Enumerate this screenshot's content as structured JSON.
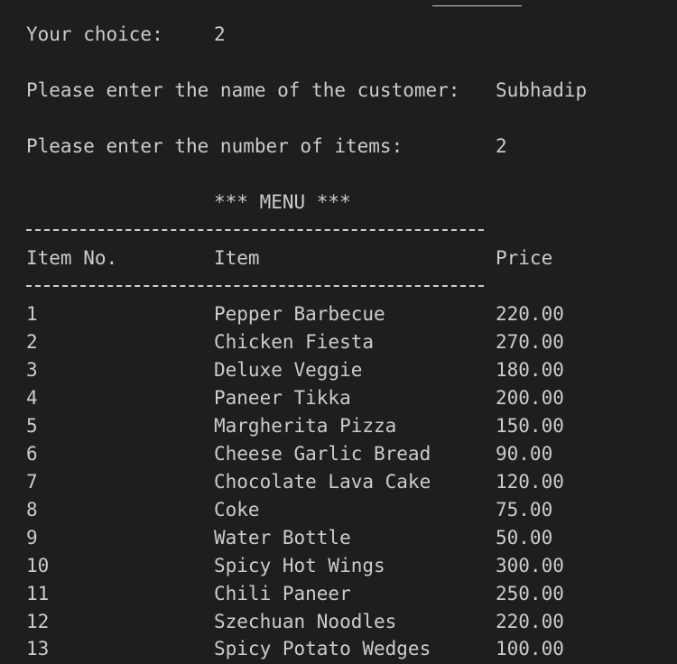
{
  "terminal": {
    "choice_prompt": "Your choice:",
    "choice_value": "2",
    "customer_prompt": "Please enter the name of the customer:",
    "customer_value": "Subhadip",
    "items_prompt": "Please enter the number of items:",
    "items_value": "2",
    "menu_title": "*** MENU ***",
    "headers": {
      "no": "Item No.",
      "item": "Item",
      "price": "Price"
    },
    "rows": [
      {
        "no": "1",
        "item": "Pepper Barbecue",
        "price": "220.00"
      },
      {
        "no": "2",
        "item": "Chicken Fiesta",
        "price": "270.00"
      },
      {
        "no": "3",
        "item": "Deluxe Veggie",
        "price": "180.00"
      },
      {
        "no": "4",
        "item": "Paneer Tikka",
        "price": "200.00"
      },
      {
        "no": "5",
        "item": "Margherita Pizza",
        "price": "150.00"
      },
      {
        "no": "6",
        "item": "Cheese Garlic Bread",
        "price": "90.00"
      },
      {
        "no": "7",
        "item": "Chocolate Lava Cake",
        "price": "120.00"
      },
      {
        "no": "8",
        "item": "Coke",
        "price": "75.00"
      },
      {
        "no": "9",
        "item": "Water Bottle",
        "price": "50.00"
      },
      {
        "no": "10",
        "item": "Spicy Hot Wings",
        "price": "300.00"
      },
      {
        "no": "11",
        "item": "Chili Paneer",
        "price": "250.00"
      },
      {
        "no": "12",
        "item": "Szechuan Noodles",
        "price": "220.00"
      },
      {
        "no": "13",
        "item": "Spicy Potato Wedges",
        "price": "100.00"
      }
    ]
  },
  "colors": {
    "background": "#1e1e1e",
    "text": "#cccccc"
  }
}
